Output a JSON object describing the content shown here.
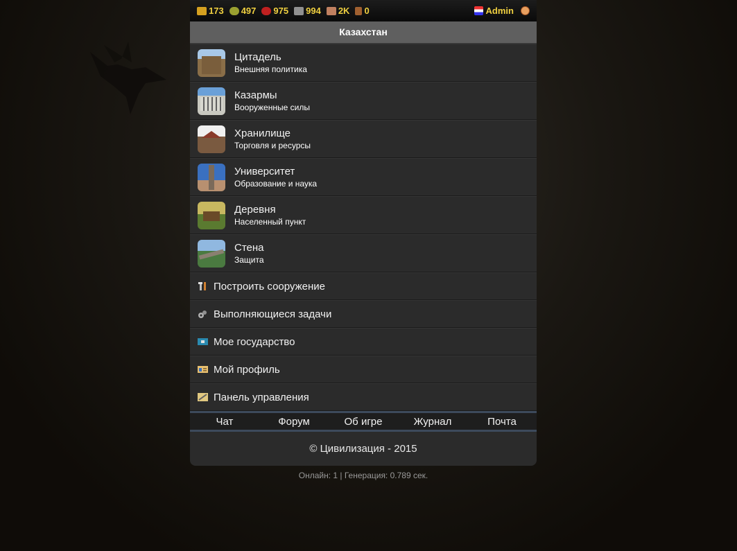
{
  "resources": [
    {
      "icon": "gold-icon",
      "value": "173",
      "color": "#d4a020"
    },
    {
      "icon": "wood-icon",
      "value": "497",
      "color": "#9aa030"
    },
    {
      "icon": "meat-icon",
      "value": "975",
      "color": "#c02020"
    },
    {
      "icon": "iron-icon",
      "value": "994",
      "color": "#909090"
    },
    {
      "icon": "stone-icon",
      "value": "2K",
      "color": "#c08060"
    },
    {
      "icon": "tool-icon",
      "value": "0",
      "color": "#a06030"
    }
  ],
  "user": {
    "name": "Admin"
  },
  "title": "Казахстан",
  "buildings": [
    {
      "name": "Цитадель",
      "sub": "Внешняя политика"
    },
    {
      "name": "Казармы",
      "sub": "Вооруженные силы"
    },
    {
      "name": "Хранилище",
      "sub": "Торговля и ресурсы"
    },
    {
      "name": "Университет",
      "sub": "Образование и наука"
    },
    {
      "name": "Деревня",
      "sub": "Населенный пункт"
    },
    {
      "name": "Стена",
      "sub": "Защита"
    }
  ],
  "actions": [
    {
      "label": "Построить сооружение",
      "icon": "tools-icon"
    },
    {
      "label": "Выполняющиеся задачи",
      "icon": "gears-icon"
    },
    {
      "label": "Мое государство",
      "icon": "state-icon"
    },
    {
      "label": "Мой профиль",
      "icon": "profile-card-icon"
    },
    {
      "label": "Панель управления",
      "icon": "control-panel-icon"
    }
  ],
  "nav": [
    "Чат",
    "Форум",
    "Об игре",
    "Журнал",
    "Почта"
  ],
  "footer": "© Цивилизация - 2015",
  "stats": "Онлайн: 1 | Генерация: 0.789 сек."
}
